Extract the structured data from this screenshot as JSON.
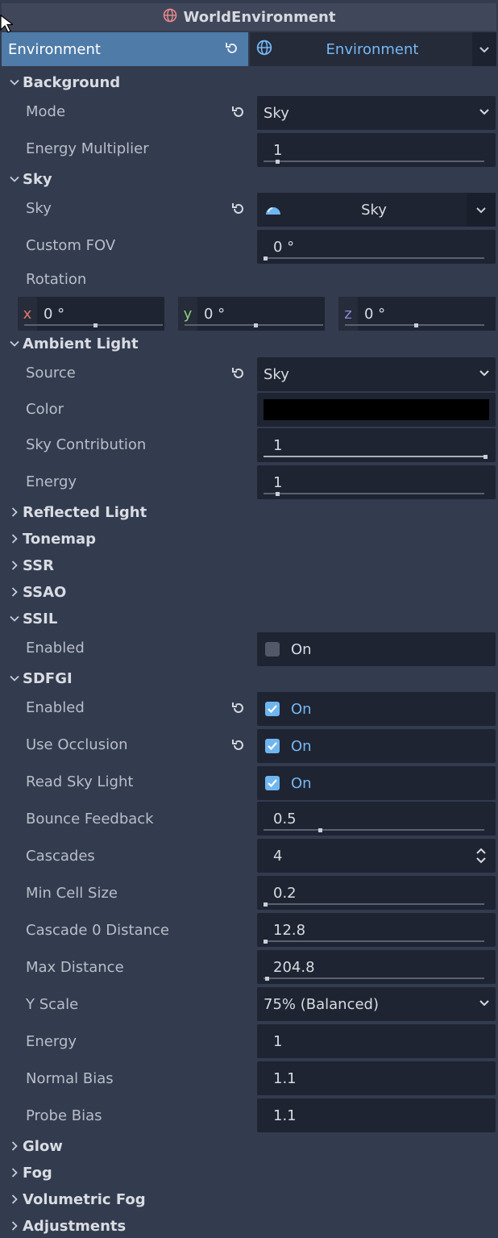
{
  "title": "WorldEnvironment",
  "resource": {
    "property_label": "Environment",
    "value": "Environment"
  },
  "sections": {
    "background": "Background",
    "sky": "Sky",
    "ambient_light": "Ambient Light",
    "reflected_light": "Reflected Light",
    "tonemap": "Tonemap",
    "ssr": "SSR",
    "ssao": "SSAO",
    "ssil": "SSIL",
    "sdfgi": "SDFGI",
    "glow": "Glow",
    "fog": "Fog",
    "volumetric_fog": "Volumetric Fog",
    "adjustments": "Adjustments"
  },
  "background": {
    "mode_label": "Mode",
    "mode_value": "Sky",
    "energy_label": "Energy Multiplier",
    "energy_value": "1"
  },
  "sky": {
    "sky_label": "Sky",
    "sky_value": "Sky",
    "fov_label": "Custom FOV",
    "fov_value": "0 °",
    "rotation_label": "Rotation",
    "rot_x_axis": "x",
    "rot_x": "0 °",
    "rot_y_axis": "y",
    "rot_y": "0 °",
    "rot_z_axis": "z",
    "rot_z": "0 °"
  },
  "ambient": {
    "source_label": "Source",
    "source_value": "Sky",
    "color_label": "Color",
    "color_value": "#000000",
    "skycontrib_label": "Sky Contribution",
    "skycontrib_value": "1",
    "energy_label": "Energy",
    "energy_value": "1"
  },
  "ssil": {
    "enabled_label": "Enabled",
    "enabled_value": "On"
  },
  "sdfgi": {
    "enabled_label": "Enabled",
    "enabled_value": "On",
    "occlusion_label": "Use Occlusion",
    "occlusion_value": "On",
    "skylight_label": "Read Sky Light",
    "skylight_value": "On",
    "bounce_label": "Bounce Feedback",
    "bounce_value": "0.5",
    "cascades_label": "Cascades",
    "cascades_value": "4",
    "mincell_label": "Min Cell Size",
    "mincell_value": "0.2",
    "cascade0_label": "Cascade 0 Distance",
    "cascade0_value": "12.8",
    "maxdist_label": "Max Distance",
    "maxdist_value": "204.8",
    "yscale_label": "Y Scale",
    "yscale_value": "75% (Balanced)",
    "energy_label": "Energy",
    "energy_value": "1",
    "normalbias_label": "Normal Bias",
    "normalbias_value": "1.1",
    "probebias_label": "Probe Bias",
    "probebias_value": "1.1"
  },
  "colors": {
    "accent": "#75b8f5",
    "header_selected": "#4e7ba8",
    "panel": "#333b4f",
    "field": "#1f2432"
  },
  "icons": {
    "globe": "globe-icon",
    "revert": "revert-icon",
    "chevron": "chevron-icon",
    "checkbox": "checkbox-icon"
  }
}
